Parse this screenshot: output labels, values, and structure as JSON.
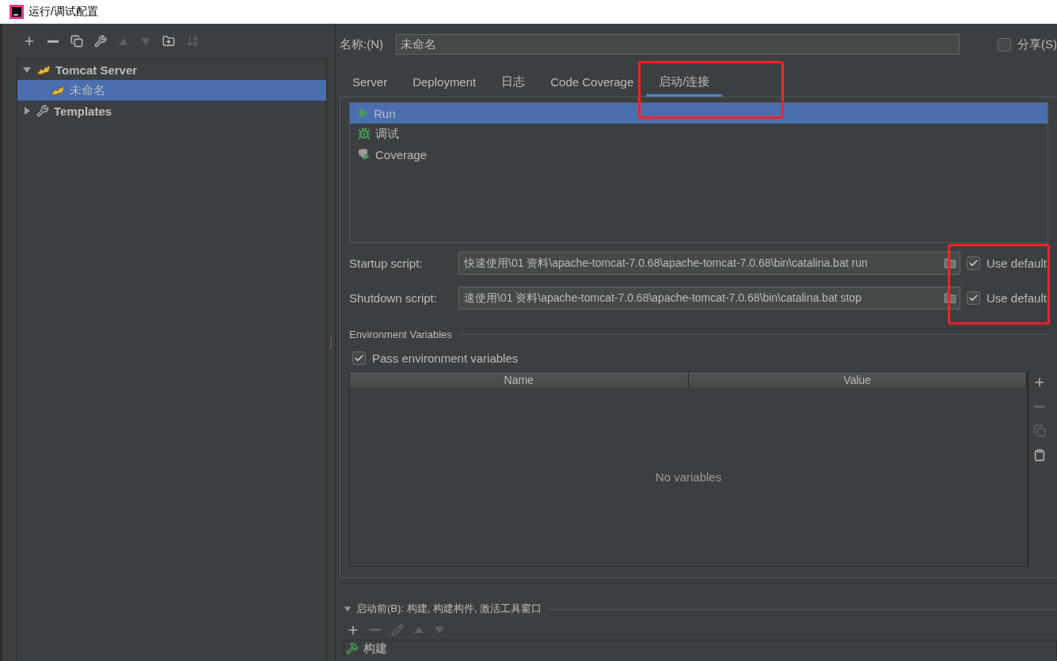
{
  "window": {
    "title": "运行/调试配置"
  },
  "left_toolbar": [
    {
      "kind": "add",
      "disabled": false
    },
    {
      "kind": "remove",
      "disabled": false
    },
    {
      "kind": "copy",
      "disabled": false
    },
    {
      "kind": "wrench",
      "disabled": false
    },
    {
      "kind": "up",
      "disabled": true
    },
    {
      "kind": "down",
      "disabled": true
    },
    {
      "kind": "folder-add",
      "disabled": false
    },
    {
      "kind": "sort",
      "disabled": true
    }
  ],
  "tree": [
    {
      "label": "Tomcat Server",
      "kind": "tomcat",
      "expanded": true,
      "selected": false,
      "children": [
        {
          "label": "未命名",
          "kind": "tomcat",
          "selected": true
        }
      ]
    },
    {
      "label": "Templates",
      "kind": "wrench",
      "expanded": false,
      "selected": false
    }
  ],
  "name_field": {
    "label": "名称:(N)",
    "value": "未命名"
  },
  "share": {
    "label": "分享(S)",
    "checked": false
  },
  "tabs": [
    {
      "label": "Server",
      "selected": false
    },
    {
      "label": "Deployment",
      "selected": false
    },
    {
      "label": "日志",
      "selected": false
    },
    {
      "label": "Code Coverage",
      "selected": false
    },
    {
      "label": "启动/连接",
      "selected": true
    }
  ],
  "launch_modes": [
    {
      "label": "Run",
      "kind": "run",
      "selected": true
    },
    {
      "label": "调试",
      "kind": "debug",
      "selected": false
    },
    {
      "label": "Coverage",
      "kind": "coverage",
      "selected": false
    }
  ],
  "scripts": [
    {
      "label": "Startup script:",
      "value": "快速使用\\01 资料\\apache-tomcat-7.0.68\\apache-tomcat-7.0.68\\bin\\catalina.bat run",
      "use_default": {
        "label": "Use default",
        "checked": true
      }
    },
    {
      "label": "Shutdown script:",
      "value": "速使用\\01 资料\\apache-tomcat-7.0.68\\apache-tomcat-7.0.68\\bin\\catalina.bat stop",
      "use_default": {
        "label": "Use default",
        "checked": true
      }
    }
  ],
  "env": {
    "title": "Environment Variables",
    "pass": {
      "label": "Pass environment variables",
      "checked": true
    },
    "columns": [
      "Name",
      "Value"
    ],
    "empty_text": "No variables",
    "tools": [
      {
        "kind": "add",
        "disabled": false
      },
      {
        "kind": "remove",
        "disabled": true
      },
      {
        "kind": "copy",
        "disabled": true
      },
      {
        "kind": "paste",
        "disabled": false
      }
    ]
  },
  "before_launch": {
    "title": "启动前(B): 构建, 构建构件, 激活工具窗口",
    "expanded": true,
    "tools": [
      {
        "kind": "add",
        "disabled": false
      },
      {
        "kind": "remove",
        "disabled": true
      },
      {
        "kind": "edit",
        "disabled": true
      },
      {
        "kind": "up",
        "disabled": true
      },
      {
        "kind": "down",
        "disabled": true
      }
    ],
    "items": [
      {
        "label": "构建",
        "kind": "build"
      }
    ]
  }
}
